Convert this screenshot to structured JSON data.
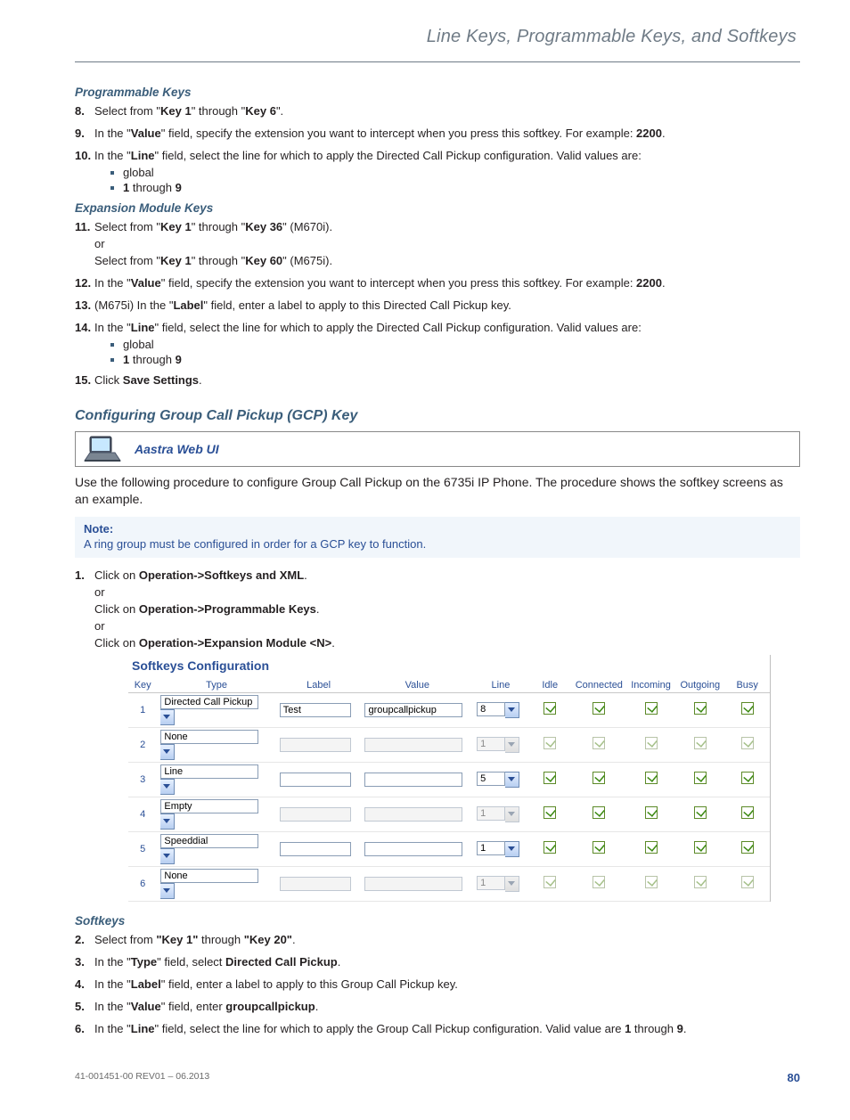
{
  "running_head": "Line Keys, Programmable Keys, and Softkeys",
  "programmable_keys": {
    "heading": "Programmable Keys",
    "steps": {
      "s8": {
        "num": "8.",
        "t1": "Select from \"",
        "k1": "Key 1",
        "t2": "\" through \"",
        "k2": "Key 6",
        "t3": "\"."
      },
      "s9": {
        "num": "9.",
        "t1": "In the \"",
        "k1": "Value",
        "t2": "\" field, specify the extension you want to intercept when you press this softkey. For example: ",
        "ex": "2200",
        "t3": "."
      },
      "s10": {
        "num": "10.",
        "t1": "In the \"",
        "k1": "Line",
        "t2": "\" field, select the line for which to apply the Directed Call Pickup configuration. Valid values are:"
      }
    },
    "bullets": {
      "b1": "global",
      "b2_a": "1",
      "b2_mid": " through ",
      "b2_b": "9"
    }
  },
  "expansion": {
    "heading": "Expansion Module Keys",
    "s11": {
      "num": "11.",
      "l1_a": "Select from \"",
      "l1_k1": "Key 1",
      "l1_b": "\" through \"",
      "l1_k2": "Key 36",
      "l1_c": "\" (M670i).",
      "or": "or",
      "l2_a": "Select from \"",
      "l2_k1": "Key 1",
      "l2_b": "\" through \"",
      "l2_k2": "Key 60",
      "l2_c": "\" (M675i)."
    },
    "s12": {
      "num": "12.",
      "t1": "In the \"",
      "k1": "Value",
      "t2": "\" field, specify the extension you want to intercept when you press this softkey. For example: ",
      "ex": "2200",
      "t3": "."
    },
    "s13": {
      "num": "13.",
      "t1": "(M675i) In the \"",
      "k1": "Label",
      "t2": "\" field, enter a label to apply to this Directed Call Pickup key."
    },
    "s14": {
      "num": "14.",
      "t1": "In the \"",
      "k1": "Line",
      "t2": "\" field, select the line for which to apply the Directed Call Pickup configuration. Valid values are:"
    },
    "bullets": {
      "b1": "global",
      "b2_a": "1",
      "b2_mid": " through ",
      "b2_b": "9"
    },
    "s15": {
      "num": "15.",
      "t1": "Click ",
      "k1": "Save Settings",
      "t2": "."
    }
  },
  "gcp": {
    "heading": "Configuring Group Call Pickup (GCP) Key",
    "webui_label": "Aastra Web UI",
    "intro": "Use the following procedure to configure Group Call Pickup on the 6735i IP Phone. The procedure shows the softkey screens as an example.",
    "note_title": "Note:",
    "note_body": "A ring group must be configured in order for a GCP key to function.",
    "s1": {
      "num": "1.",
      "a": "Click on ",
      "b1": "Operation->Softkeys and XML",
      "c": ".",
      "or1": "or",
      "d": "Click on ",
      "b2": "Operation->Programmable Keys",
      "e": ".",
      "or2": "or",
      "f": "Click on ",
      "b3": "Operation->Expansion Module <N>",
      "g": "."
    }
  },
  "softkeys_cfg": {
    "title": "Softkeys Configuration",
    "headers": {
      "key": "Key",
      "type": "Type",
      "label": "Label",
      "value": "Value",
      "line": "Line",
      "idle": "Idle",
      "connected": "Connected",
      "incoming": "Incoming",
      "outgoing": "Outgoing",
      "busy": "Busy"
    },
    "rows": [
      {
        "key": "1",
        "type": "Directed Call Pickup",
        "label": "Test",
        "value": "groupcallpickup",
        "line": "8",
        "enabled": true,
        "checks": [
          true,
          true,
          true,
          true,
          true
        ]
      },
      {
        "key": "2",
        "type": "None",
        "label": "",
        "value": "",
        "line": "1",
        "enabled": false,
        "checks": [
          true,
          true,
          true,
          true,
          true
        ]
      },
      {
        "key": "3",
        "type": "Line",
        "label": "",
        "value": "",
        "line": "5",
        "enabled": true,
        "checks": [
          true,
          true,
          true,
          true,
          true
        ]
      },
      {
        "key": "4",
        "type": "Empty",
        "label": "",
        "value": "",
        "line": "1",
        "enabled": false,
        "lineEnabled": false,
        "checks": [
          true,
          true,
          true,
          true,
          true
        ],
        "checksEnabled": true
      },
      {
        "key": "5",
        "type": "Speeddial",
        "label": "",
        "value": "",
        "line": "1",
        "enabled": true,
        "checks": [
          true,
          true,
          true,
          true,
          true
        ]
      },
      {
        "key": "6",
        "type": "None",
        "label": "",
        "value": "",
        "line": "1",
        "enabled": false,
        "checks": [
          true,
          true,
          true,
          true,
          true
        ]
      }
    ]
  },
  "softkeys": {
    "heading": "Softkeys",
    "s2": {
      "num": "2.",
      "t1": "Select from ",
      "k1": "\"Key 1\"",
      "t2": " through ",
      "k2": "\"Key 20\"",
      "t3": "."
    },
    "s3": {
      "num": "3.",
      "t1": "In the \"",
      "k1": "Type",
      "t2": "\" field, select ",
      "k2": "Directed Call Pickup",
      "t3": "."
    },
    "s4": {
      "num": "4.",
      "t1": "In the \"",
      "k1": "Label",
      "t2": "\" field, enter a label to apply to this Group Call Pickup key."
    },
    "s5": {
      "num": "5.",
      "t1": "In the \"",
      "k1": "Value",
      "t2": "\" field, enter ",
      "k2": "groupcallpickup",
      "t3": "."
    },
    "s6": {
      "num": "6.",
      "t1": "In the \"",
      "k1": "Line",
      "t2": "\" field, select the line for which to apply the Group Call Pickup configuration. Valid value are ",
      "k2": "1",
      "t3": " through ",
      "k3": "9",
      "t4": "."
    }
  },
  "footer": {
    "rev": "41-001451-00 REV01 – 06.2013",
    "page": "80"
  }
}
